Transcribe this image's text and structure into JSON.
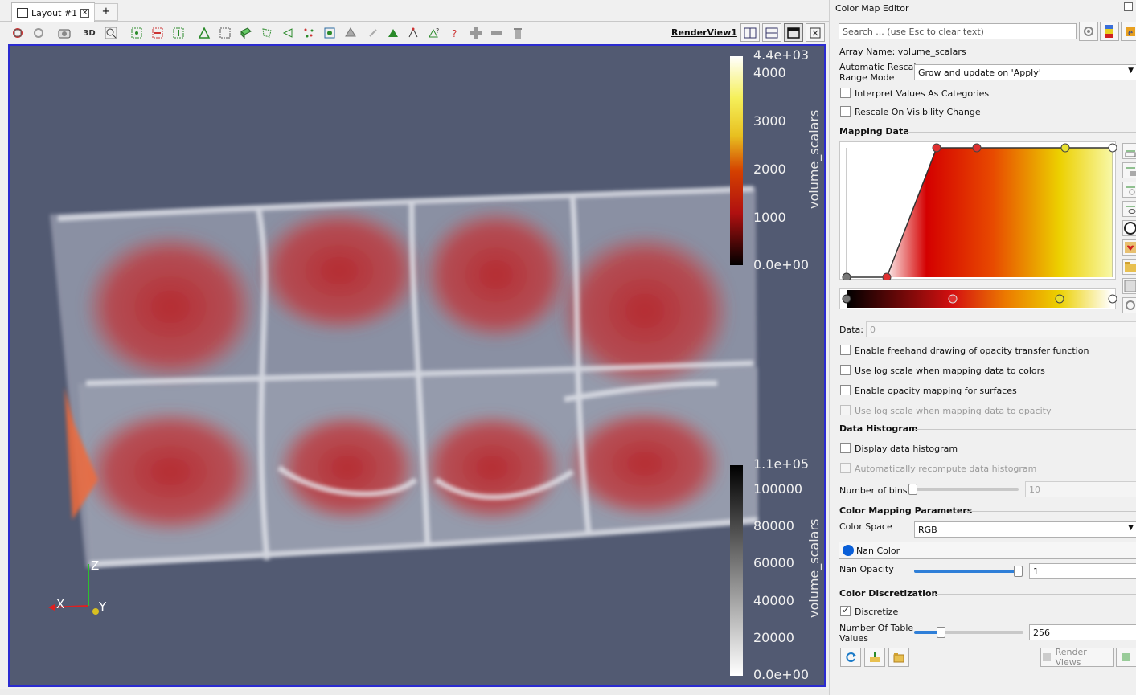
{
  "tabs": {
    "layout_label": "Layout #1",
    "add_label": "+"
  },
  "toolbar": {
    "three_d_label": "3D",
    "render_view_label": "RenderView1"
  },
  "scalar_bar_top": {
    "title": "volume_scalars",
    "ticks": [
      "4.4e+03",
      "4000",
      "3000",
      "2000",
      "1000",
      "0.0e+00"
    ],
    "colors": [
      "#ffffff",
      "#f5f05a",
      "#e8c020",
      "#d44000",
      "#b01010",
      "#000000"
    ]
  },
  "scalar_bar_bottom": {
    "title": "volume_scalars",
    "ticks": [
      "1.1e+05",
      "100000",
      "80000",
      "60000",
      "40000",
      "20000",
      "0.0e+00"
    ],
    "colors": [
      "#000000",
      "#ffffff"
    ]
  },
  "axes": {
    "x": "X",
    "y": "Y",
    "z": "Z"
  },
  "panel": {
    "title": "Color Map Editor",
    "search_placeholder": "Search ... (use Esc to clear text)",
    "array_name": "Array Name: volume_scalars",
    "rescale_label_1": "Automatic Rescale",
    "rescale_label_2": "Range Mode",
    "rescale_value": "Grow and update on 'Apply'",
    "interpret_categories": "Interpret Values As Categories",
    "rescale_visibility": "Rescale On Visibility Change",
    "mapping_data_header": "Mapping Data",
    "data_label": "Data:",
    "data_value": "0",
    "freehand": "Enable freehand drawing of opacity transfer function",
    "log_colors": "Use log scale when mapping data to colors",
    "opacity_surfaces": "Enable opacity mapping for surfaces",
    "log_opacity": "Use log scale when mapping data to opacity",
    "histogram_header": "Data Histogram",
    "display_histogram": "Display data histogram",
    "auto_recompute": "Automatically recompute data histogram",
    "bins_label": "Number of bins:",
    "bins_value": "10",
    "bins_fraction": 0.02,
    "mapping_params_header": "Color Mapping Parameters",
    "color_space_label": "Color Space",
    "color_space_value": "RGB",
    "nan_color_label": "Nan Color",
    "nan_color": "#0a5fd8",
    "nan_opacity_label": "Nan Opacity",
    "nan_opacity_value": "1",
    "nan_opacity_fraction": 1.0,
    "discretization_header": "Color Discretization",
    "discretize_label": "Discretize",
    "discretize_checked": true,
    "table_values_label_1": "Number Of Table",
    "table_values_label_2": "Values",
    "table_values_value": "256",
    "table_values_fraction": 0.25,
    "render_views_label": "Render Views"
  },
  "accent_color": "#2b2bd0",
  "viewport_background": "#525a72"
}
